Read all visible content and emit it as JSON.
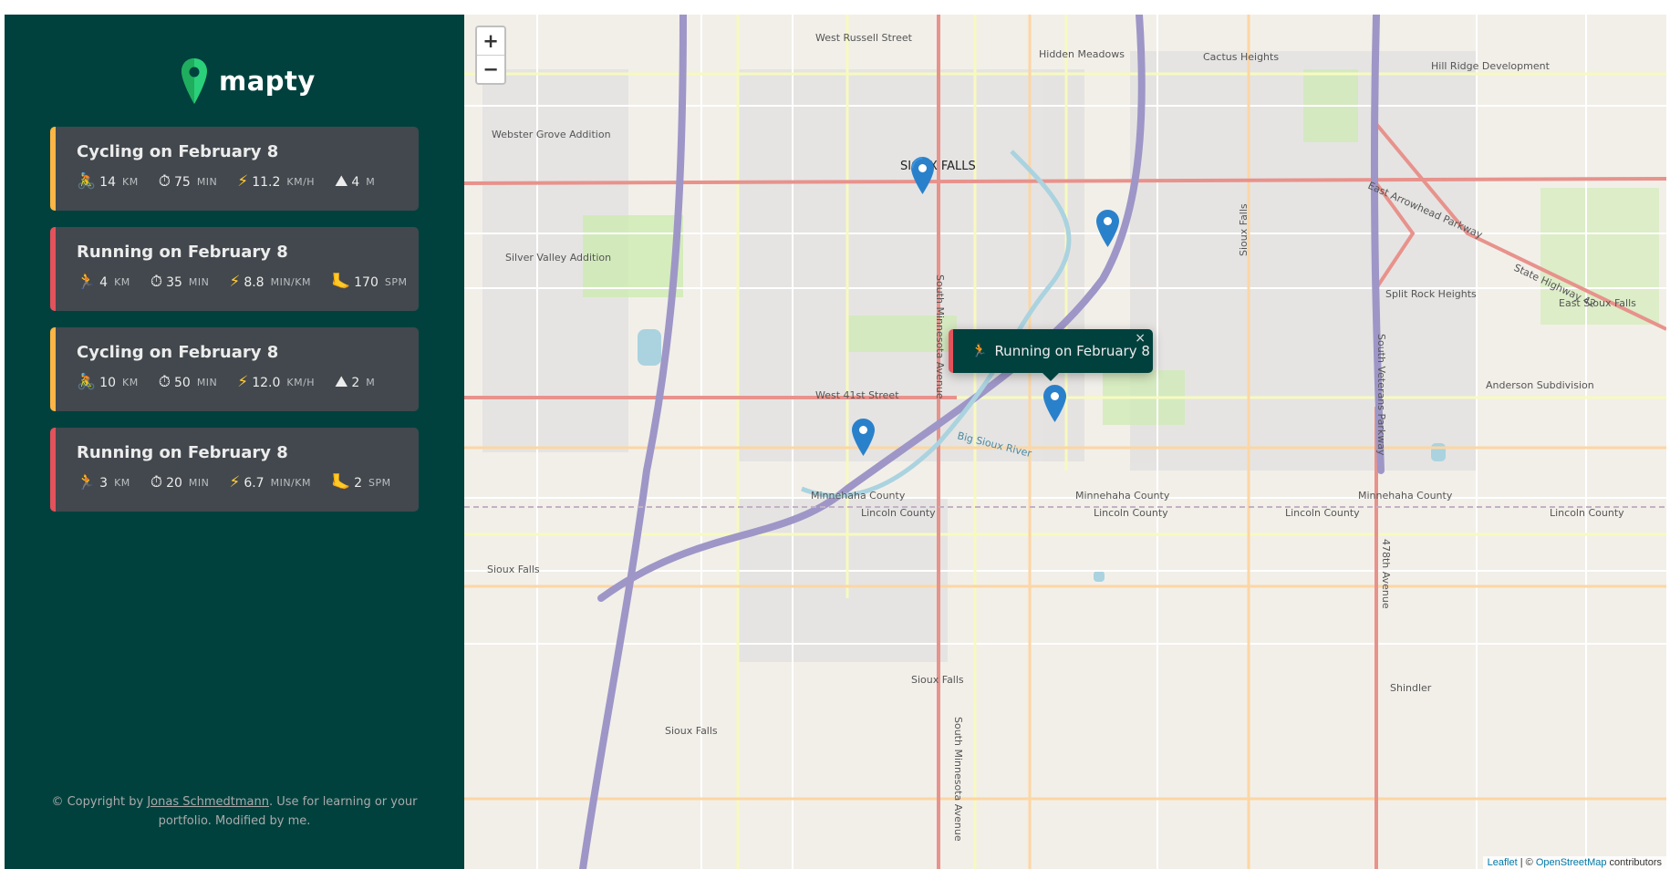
{
  "logo": {
    "text": "mapty",
    "icon": "map-pin-icon"
  },
  "workouts": [
    {
      "type": "cycling",
      "title": "Cycling on February 8",
      "color": "#ffb545",
      "distance": "14",
      "distance_unit": "km",
      "duration": "75",
      "duration_unit": "min",
      "speed": "11.2",
      "speed_unit": "km/h",
      "extra": "4",
      "extra_unit": "m",
      "icons": [
        "bike-icon",
        "stopwatch-icon",
        "lightning-icon",
        "mountain-icon"
      ]
    },
    {
      "type": "running",
      "title": "Running on February 8",
      "color": "#e4525b",
      "distance": "4",
      "distance_unit": "km",
      "duration": "35",
      "duration_unit": "min",
      "speed": "8.8",
      "speed_unit": "min/km",
      "extra": "170",
      "extra_unit": "spm",
      "icons": [
        "runner-icon",
        "stopwatch-icon",
        "lightning-icon",
        "foot-icon"
      ]
    },
    {
      "type": "cycling",
      "title": "Cycling on February 8",
      "color": "#ffb545",
      "distance": "10",
      "distance_unit": "km",
      "duration": "50",
      "duration_unit": "min",
      "speed": "12.0",
      "speed_unit": "km/h",
      "extra": "2",
      "extra_unit": "m",
      "icons": [
        "bike-icon",
        "stopwatch-icon",
        "lightning-icon",
        "mountain-icon"
      ]
    },
    {
      "type": "running",
      "title": "Running on February 8",
      "color": "#e4525b",
      "distance": "3",
      "distance_unit": "km",
      "duration": "20",
      "duration_unit": "min",
      "speed": "6.7",
      "speed_unit": "min/km",
      "extra": "2",
      "extra_unit": "spm",
      "icons": [
        "runner-icon",
        "stopwatch-icon",
        "lightning-icon",
        "foot-icon"
      ]
    }
  ],
  "copyright": {
    "prefix": "© Copyright by ",
    "author": "Jonas Schmedtmann",
    "suffix": ". Use for learning or your portfolio. Modified by me."
  },
  "map": {
    "zoom_in": "+",
    "zoom_out": "−",
    "popup": {
      "text": "Running on February 8",
      "close": "×"
    },
    "attribution": {
      "leaflet": "Leaflet",
      "separator": " | © ",
      "osm": "OpenStreetMap",
      "suffix": " contributors"
    },
    "labels": {
      "west_russell": "West Russell Street",
      "hidden_meadows": "Hidden Meadows",
      "cactus_heights": "Cactus Heights",
      "hill_ridge": "Hill Ridge Development",
      "webster_grove": "Webster Grove Addition",
      "sioux_falls_city": "SIOUX FALLS",
      "east_arrowhead": "East Arrowhead Parkway",
      "state_hwy_42": "State Highway 42",
      "east_sioux_falls": "East Sioux Falls",
      "silver_valley": "Silver Valley Addition",
      "split_rock": "Split Rock Heights",
      "south_minnesota": "South Minnesota Avenue",
      "south_veterans": "South Veterans Parkway",
      "sioux_falls_vertical": "Sioux Falls",
      "anderson": "Anderson Subdivision",
      "west_41st": "West 41st Street",
      "big_sioux": "Big Sioux River",
      "minnehaha": "Minnehaha County",
      "lincoln": "Lincoln County",
      "sioux_falls": "Sioux Falls",
      "shindler": "Shindler",
      "ave_478": "478th Avenue"
    }
  }
}
